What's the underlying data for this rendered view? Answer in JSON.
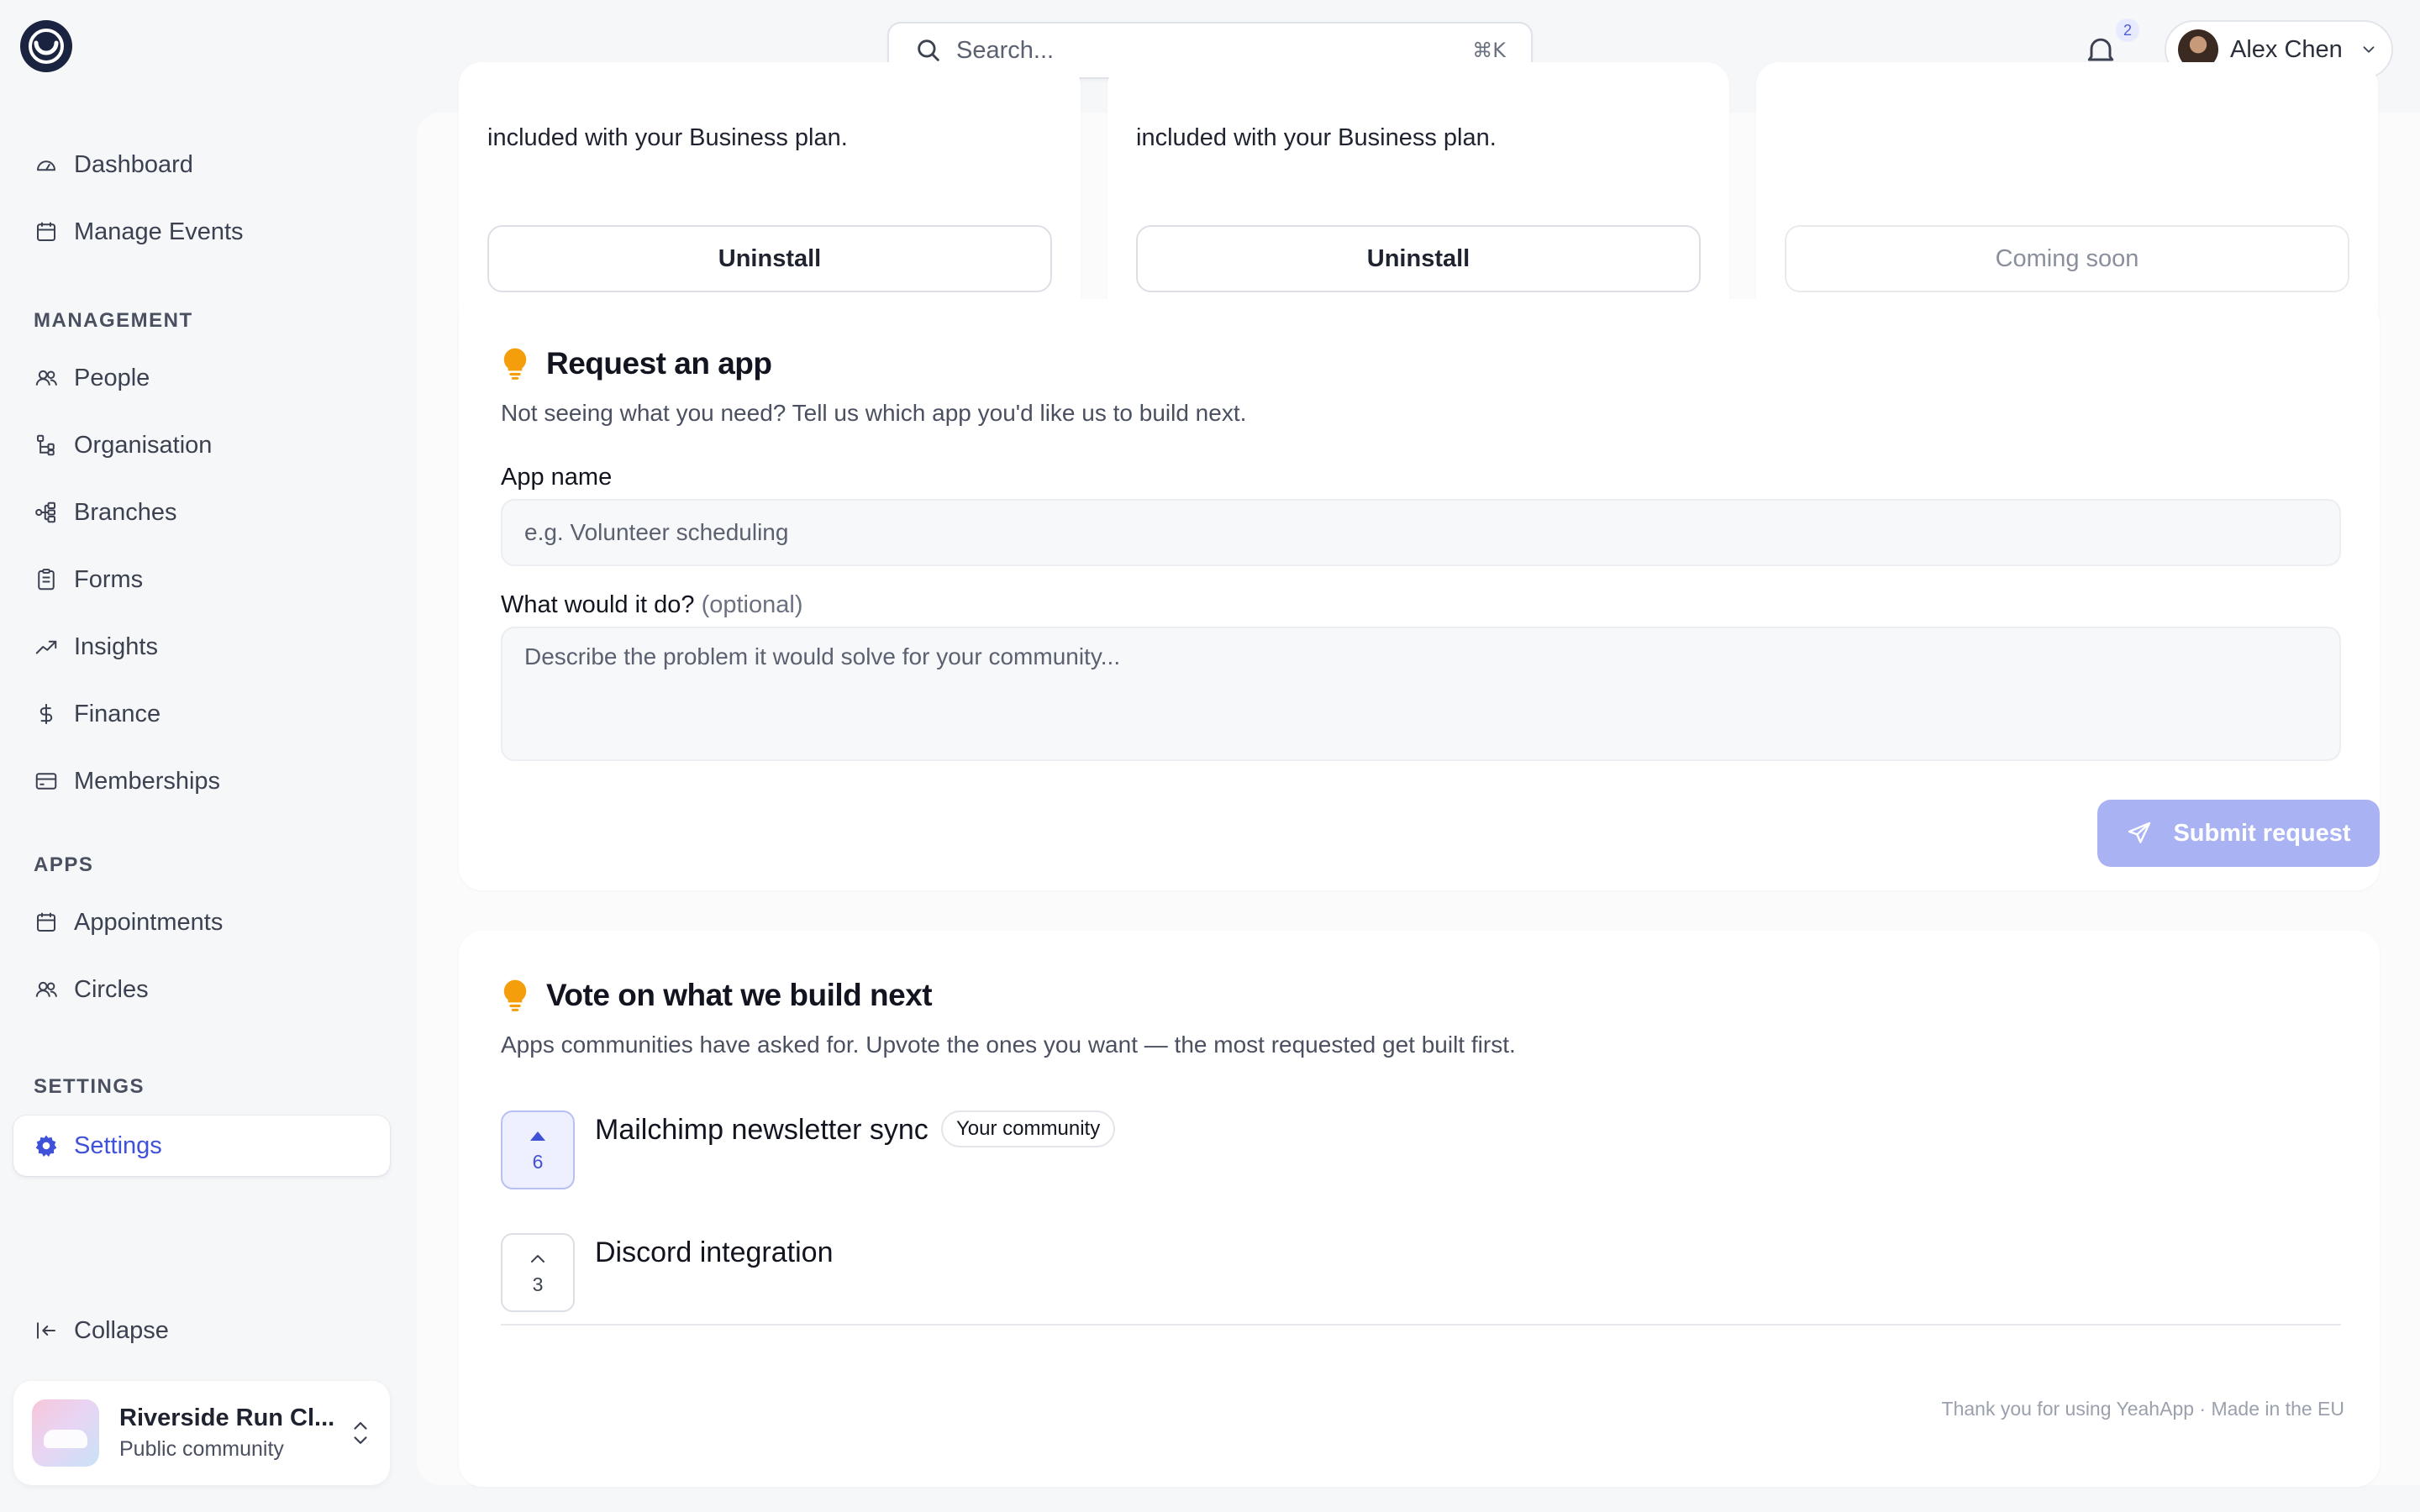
{
  "topbar": {
    "search_placeholder": "Search...",
    "search_shortcut": "⌘K",
    "notification_count": "2",
    "user_name": "Alex Chen"
  },
  "sidebar": {
    "primary": [
      {
        "label": "Dashboard",
        "icon": "gauge-icon"
      },
      {
        "label": "Manage Events",
        "icon": "calendar-icon"
      }
    ],
    "management_heading": "MANAGEMENT",
    "management": [
      {
        "label": "People",
        "icon": "people-icon"
      },
      {
        "label": "Organisation",
        "icon": "org-tree-icon"
      },
      {
        "label": "Branches",
        "icon": "branches-icon"
      },
      {
        "label": "Forms",
        "icon": "clipboard-icon"
      },
      {
        "label": "Insights",
        "icon": "trend-icon"
      },
      {
        "label": "Finance",
        "icon": "dollar-icon"
      },
      {
        "label": "Memberships",
        "icon": "card-icon"
      }
    ],
    "apps_heading": "APPS",
    "apps": [
      {
        "label": "Appointments",
        "icon": "calendar-icon"
      },
      {
        "label": "Circles",
        "icon": "people-icon"
      }
    ],
    "settings_heading": "SETTINGS",
    "settings": {
      "label": "Settings",
      "icon": "gear-icon",
      "active": true
    },
    "collapse_label": "Collapse",
    "org": {
      "name": "Riverside Run Cl...",
      "type": "Public community"
    }
  },
  "apps_row": [
    {
      "description": "included with your Business plan.",
      "button": "Uninstall",
      "disabled": false
    },
    {
      "description": "included with your Business plan.",
      "button": "Uninstall",
      "disabled": false
    },
    {
      "description": "",
      "button": "Coming soon",
      "disabled": true
    }
  ],
  "request": {
    "title": "Request an app",
    "subtitle": "Not seeing what you need? Tell us which app you'd like us to build next.",
    "app_name_label": "App name",
    "app_name_placeholder": "e.g. Volunteer scheduling",
    "what_label": "What would it do?",
    "what_optional": "(optional)",
    "what_placeholder": "Describe the problem it would solve for your community...",
    "submit_label": "Submit request"
  },
  "vote": {
    "title": "Vote on what we build next",
    "subtitle": "Apps communities have asked for. Upvote the ones you want — the most requested get built first.",
    "items": [
      {
        "title": "Mailchimp newsletter sync",
        "votes": "6",
        "badge": "Your community",
        "voted": true
      },
      {
        "title": "Discord integration",
        "votes": "3",
        "badge": "",
        "voted": false
      }
    ]
  },
  "footer": "Thank you for using YeahApp · Made in the EU",
  "colors": {
    "accent": "#3f51d8",
    "submit_disabled": "#a9b3f3",
    "bulb": "#f59e0b"
  }
}
